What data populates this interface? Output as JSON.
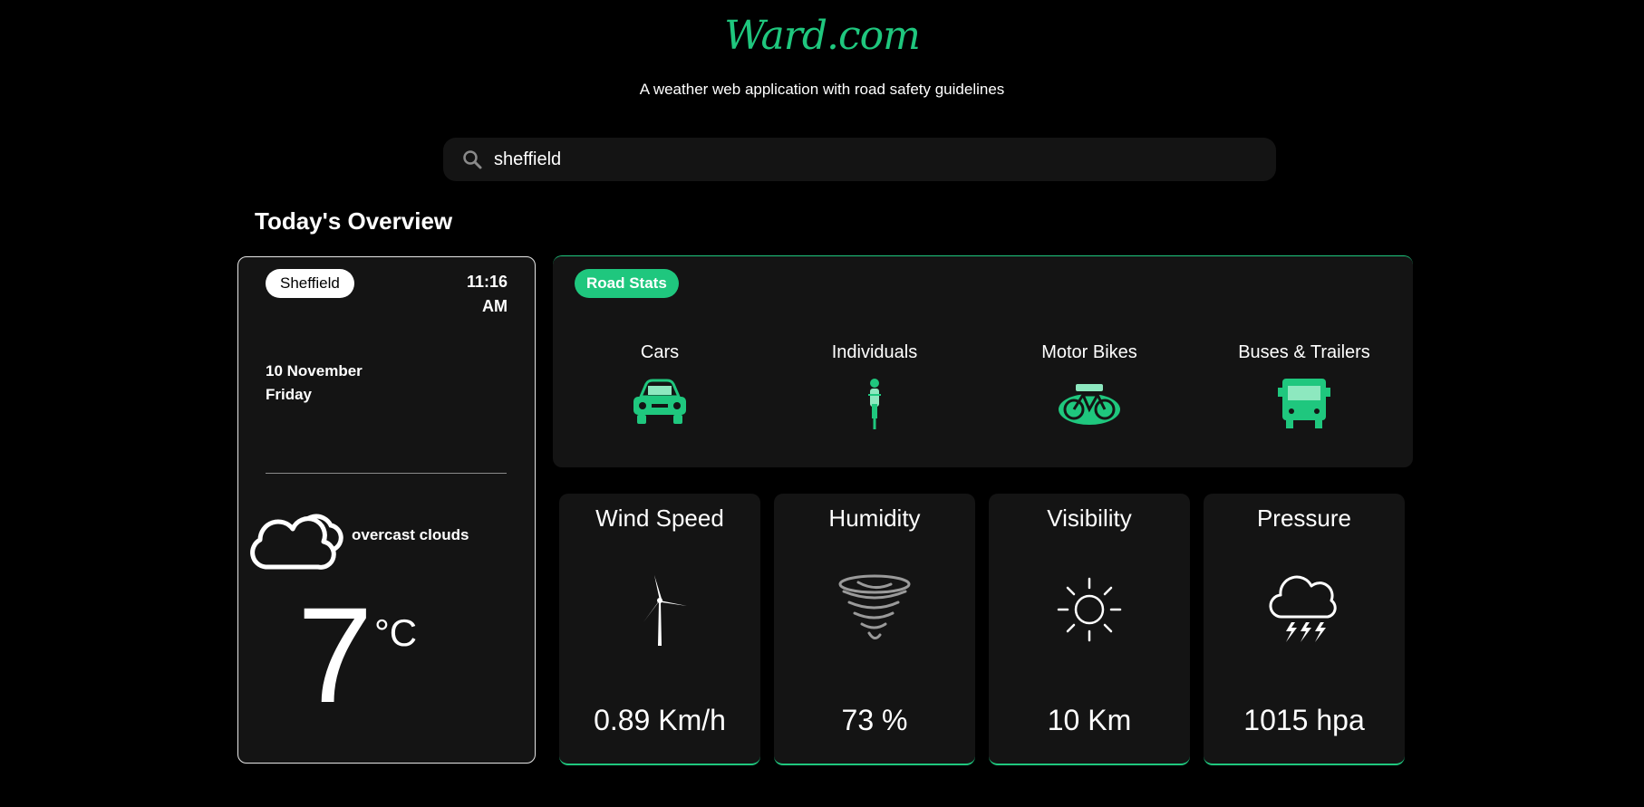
{
  "header": {
    "logo": "Ward.com",
    "tagline": "A weather web application with road safety guidelines"
  },
  "search": {
    "value": "sheffield",
    "icon": "search-icon"
  },
  "overview": {
    "title": "Today's Overview"
  },
  "location_card": {
    "city": "Sheffield",
    "time": "11:16",
    "meridiem": "AM",
    "date": "10 November",
    "weekday": "Friday",
    "weather_icon": "cloud-icon",
    "description": "overcast clouds",
    "temperature": "7",
    "unit": "°C"
  },
  "road_stats": {
    "badge": "Road Stats",
    "items": [
      {
        "label": "Cars",
        "icon": "car-icon"
      },
      {
        "label": "Individuals",
        "icon": "cyclist-person-icon"
      },
      {
        "label": "Motor Bikes",
        "icon": "bike-icon"
      },
      {
        "label": "Buses & Trailers",
        "icon": "bus-icon"
      }
    ]
  },
  "stats": [
    {
      "title": "Wind Speed",
      "value": "0.89 Km/h",
      "icon": "wind-turbine-icon"
    },
    {
      "title": "Humidity",
      "value": "73 %",
      "icon": "tornado-icon"
    },
    {
      "title": "Visibility",
      "value": "10 Km",
      "icon": "sun-icon"
    },
    {
      "title": "Pressure",
      "value": "1015 hpa",
      "icon": "storm-cloud-icon"
    }
  ],
  "colors": {
    "accent": "#1fc77e",
    "background": "#000000",
    "card": "#141414"
  }
}
